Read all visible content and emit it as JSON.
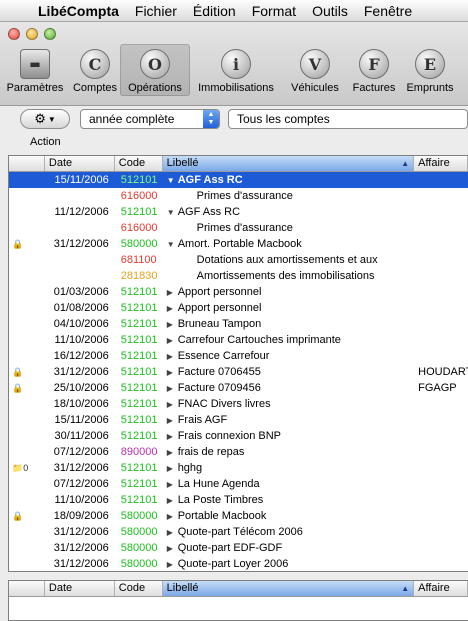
{
  "menubar": {
    "app": "LibéCompta",
    "items": [
      "Fichier",
      "Édition",
      "Format",
      "Outils",
      "Fenêtre"
    ]
  },
  "toolbar": [
    {
      "label": "Paramètres",
      "glyph": "▬",
      "icon": "settings-box-icon"
    },
    {
      "label": "Comptes",
      "glyph": "C",
      "icon": "comptes-c-icon"
    },
    {
      "label": "Opérations",
      "glyph": "O",
      "icon": "operations-o-icon",
      "selected": true
    },
    {
      "label": "Immobilisations",
      "glyph": "i",
      "icon": "immobilisations-i-icon"
    },
    {
      "label": "Véhicules",
      "glyph": "V",
      "icon": "vehicules-v-icon"
    },
    {
      "label": "Factures",
      "glyph": "F",
      "icon": "factures-f-icon"
    },
    {
      "label": "Emprunts",
      "glyph": "E",
      "icon": "emprunts-e-icon"
    }
  ],
  "controls": {
    "action_label": "Action",
    "period": "année complète",
    "accounts": "Tous les comptes"
  },
  "columns": {
    "date": "Date",
    "code": "Code",
    "libelle": "Libellé",
    "affaire": "Affaire"
  },
  "rows": [
    {
      "lock": "",
      "date": "15/11/2006",
      "code": "512101",
      "cc": "g",
      "tri": "▼",
      "libelle": "AGF Ass RC",
      "affaire": "",
      "sel": true
    },
    {
      "lock": "",
      "date": "",
      "code": "616000",
      "cc": "r",
      "tri": "",
      "libelle": "Primes d'assurance",
      "affaire": "",
      "sub": true
    },
    {
      "lock": "",
      "date": "11/12/2006",
      "code": "512101",
      "cc": "g",
      "tri": "▼",
      "libelle": "AGF Ass RC",
      "affaire": ""
    },
    {
      "lock": "",
      "date": "",
      "code": "616000",
      "cc": "r",
      "tri": "",
      "libelle": "Primes d'assurance",
      "affaire": "",
      "sub": true
    },
    {
      "lock": "🔒",
      "date": "31/12/2006",
      "code": "580000",
      "cc": "g",
      "tri": "▼",
      "libelle": "Amort. Portable Macbook",
      "affaire": ""
    },
    {
      "lock": "",
      "date": "",
      "code": "681100",
      "cc": "r",
      "tri": "",
      "libelle": "Dotations aux amortissements et aux",
      "affaire": "",
      "sub": true
    },
    {
      "lock": "",
      "date": "",
      "code": "281830",
      "cc": "o",
      "tri": "",
      "libelle": "Amortissements des immobilisations",
      "affaire": "",
      "sub": true
    },
    {
      "lock": "",
      "date": "01/03/2006",
      "code": "512101",
      "cc": "g",
      "tri": "▶",
      "libelle": "Apport personnel",
      "affaire": ""
    },
    {
      "lock": "",
      "date": "01/08/2006",
      "code": "512101",
      "cc": "g",
      "tri": "▶",
      "libelle": "Apport personnel",
      "affaire": ""
    },
    {
      "lock": "",
      "date": "04/10/2006",
      "code": "512101",
      "cc": "g",
      "tri": "▶",
      "libelle": "Bruneau Tampon",
      "affaire": ""
    },
    {
      "lock": "",
      "date": "11/10/2006",
      "code": "512101",
      "cc": "g",
      "tri": "▶",
      "libelle": "Carrefour Cartouches imprimante",
      "affaire": ""
    },
    {
      "lock": "",
      "date": "16/12/2006",
      "code": "512101",
      "cc": "g",
      "tri": "▶",
      "libelle": "Essence Carrefour",
      "affaire": ""
    },
    {
      "lock": "🔒",
      "date": "31/12/2006",
      "code": "512101",
      "cc": "g",
      "tri": "▶",
      "libelle": "Facture 0706455",
      "affaire": "HOUDART"
    },
    {
      "lock": "🔒",
      "date": "25/10/2006",
      "code": "512101",
      "cc": "g",
      "tri": "▶",
      "libelle": "Facture 0709456",
      "affaire": "FGAGP"
    },
    {
      "lock": "",
      "date": "18/10/2006",
      "code": "512101",
      "cc": "g",
      "tri": "▶",
      "libelle": "FNAC Divers livres",
      "affaire": ""
    },
    {
      "lock": "",
      "date": "15/11/2006",
      "code": "512101",
      "cc": "g",
      "tri": "▶",
      "libelle": "Frais AGF",
      "affaire": ""
    },
    {
      "lock": "",
      "date": "30/11/2006",
      "code": "512101",
      "cc": "g",
      "tri": "▶",
      "libelle": "Frais connexion BNP",
      "affaire": ""
    },
    {
      "lock": "",
      "date": "07/12/2006",
      "code": "890000",
      "cc": "p",
      "tri": "▶",
      "libelle": "frais de repas",
      "affaire": ""
    },
    {
      "lock": "📁0",
      "date": "31/12/2006",
      "code": "512101",
      "cc": "g",
      "tri": "▶",
      "libelle": "hghg",
      "affaire": ""
    },
    {
      "lock": "",
      "date": "07/12/2006",
      "code": "512101",
      "cc": "g",
      "tri": "▶",
      "libelle": "La Hune Agenda",
      "affaire": ""
    },
    {
      "lock": "",
      "date": "11/10/2006",
      "code": "512101",
      "cc": "g",
      "tri": "▶",
      "libelle": "La Poste Timbres",
      "affaire": ""
    },
    {
      "lock": "🔒",
      "date": "18/09/2006",
      "code": "580000",
      "cc": "g",
      "tri": "▶",
      "libelle": "Portable Macbook",
      "affaire": ""
    },
    {
      "lock": "",
      "date": "31/12/2006",
      "code": "580000",
      "cc": "g",
      "tri": "▶",
      "libelle": "Quote-part Télécom 2006",
      "affaire": ""
    },
    {
      "lock": "",
      "date": "31/12/2006",
      "code": "580000",
      "cc": "g",
      "tri": "▶",
      "libelle": "Quote-part EDF-GDF",
      "affaire": ""
    },
    {
      "lock": "",
      "date": "31/12/2006",
      "code": "580000",
      "cc": "g",
      "tri": "▶",
      "libelle": "Quote-part Loyer 2006",
      "affaire": ""
    }
  ],
  "colors": {
    "selection": "#1c5ad6",
    "code_green": "#1fbf1f",
    "code_red": "#e43a30",
    "code_orange": "#e8a21f",
    "code_purple": "#b430b4"
  }
}
